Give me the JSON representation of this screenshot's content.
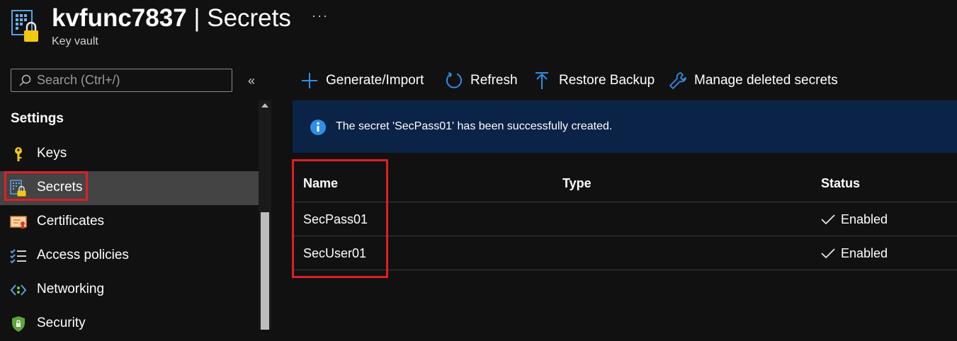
{
  "header": {
    "name": "kvfunc7837",
    "separator": " | ",
    "page": "Secrets",
    "subtitle": "Key vault",
    "more": "···"
  },
  "sidebar": {
    "search_placeholder": "Search (Ctrl+/)",
    "collapse": "«",
    "section_title": "Settings",
    "items": [
      {
        "label": "Keys",
        "icon": "key-icon"
      },
      {
        "label": "Secrets",
        "icon": "secrets-icon",
        "selected": true
      },
      {
        "label": "Certificates",
        "icon": "certificate-icon"
      },
      {
        "label": "Access policies",
        "icon": "access-policies-icon"
      },
      {
        "label": "Networking",
        "icon": "networking-icon"
      },
      {
        "label": "Security",
        "icon": "security-shield-icon"
      }
    ]
  },
  "toolbar": {
    "generate": "Generate/Import",
    "refresh": "Refresh",
    "restore": "Restore Backup",
    "manage": "Manage deleted secrets"
  },
  "banner": {
    "message": "The secret 'SecPass01' has been successfully created."
  },
  "table": {
    "columns": [
      "Name",
      "Type",
      "Status"
    ],
    "rows": [
      {
        "name": "SecPass01",
        "type": "",
        "status": "Enabled"
      },
      {
        "name": "SecUser01",
        "type": "",
        "status": "Enabled"
      }
    ]
  },
  "colors": {
    "background": "#111111",
    "banner": "#0b2346",
    "accent": "#2f8fe8",
    "highlight": "#e01e26",
    "selected": "#444444"
  }
}
